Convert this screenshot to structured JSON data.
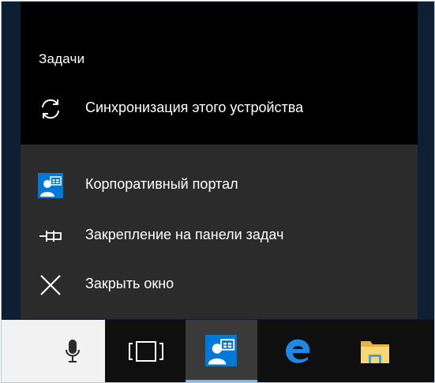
{
  "jumplist": {
    "tasks_title": "Задачи",
    "sync_label": "Синхронизация этого устройства",
    "app_label": "Корпоративный портал",
    "pin_label": "Закрепление на панели задач",
    "close_label": "Закрыть окно"
  },
  "taskbar": {
    "buttons": [
      "microphone-icon",
      "task-view-icon",
      "company-portal-icon",
      "edge-icon",
      "file-explorer-icon"
    ],
    "active": "company-portal-icon"
  },
  "colors": {
    "accent": "#0078d7",
    "jumplist_top": "#000000",
    "jumplist_bottom": "#2b2b2b",
    "taskbar": "#0f0f0f",
    "active_indicator": "#76b9ed"
  }
}
